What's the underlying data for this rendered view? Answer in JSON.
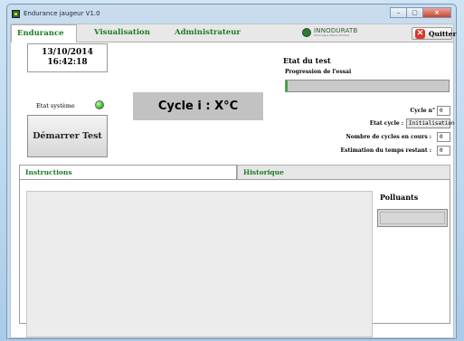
{
  "window": {
    "title": "Endurance jaugeur V1.0",
    "controls": {
      "minimize": "–",
      "maximize": "▢",
      "close": "×"
    }
  },
  "menu": {
    "tabs": [
      {
        "label": "Endurance",
        "active": true
      },
      {
        "label": "Visualisation",
        "active": false
      },
      {
        "label": "Administrateur",
        "active": false
      }
    ],
    "logo": {
      "text": "INNODURATB",
      "subtitle": "Technologies Lithium-Airbrimes"
    },
    "quit_label": "Quitter"
  },
  "left": {
    "date": "13/10/2014",
    "time": "16:42:18",
    "system_state_label": "Etat système",
    "system_state_color": "#3fcc2b",
    "start_button_label": "Démarrer Test"
  },
  "center": {
    "cycle_display": "Cycle i : X°C"
  },
  "test_state": {
    "title": "Etat du test",
    "progress_label": "Progression de l'essai",
    "progress_fraction": 0.01,
    "progress_color": "#35a82c",
    "fields": [
      {
        "label": "Cycle n°",
        "value": "0"
      },
      {
        "label": "Etat cycle :",
        "value": "Initialisation"
      },
      {
        "label": "Nombre de cycles en cours :",
        "value": "0"
      },
      {
        "label": "Estimation du temps restant :",
        "value": "0"
      }
    ]
  },
  "bottom_tabs": [
    {
      "label": "Instructions",
      "active": true
    },
    {
      "label": "Historique",
      "active": false
    }
  ],
  "polluants": {
    "label": "Polluants"
  }
}
